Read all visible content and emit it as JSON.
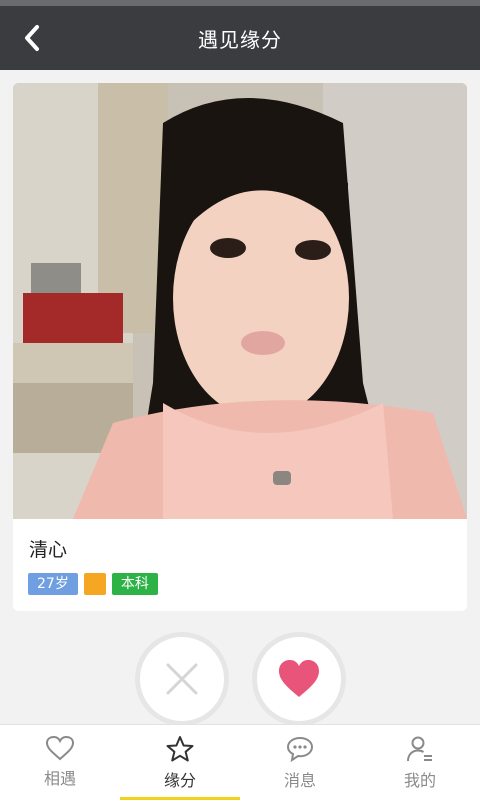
{
  "header": {
    "title": "遇见缘分",
    "back_icon": "chevron-left-icon"
  },
  "profile": {
    "name": "清心",
    "tags": {
      "age": "27岁",
      "star_color": "#f5a623",
      "education": "本科"
    }
  },
  "actions": {
    "dislike_icon": "close-icon",
    "like_icon": "heart-icon",
    "like_color": "#e9547b"
  },
  "tabs": [
    {
      "label": "相遇",
      "icon": "heart-outline-icon"
    },
    {
      "label": "缘分",
      "icon": "star-icon",
      "active": true
    },
    {
      "label": "消息",
      "icon": "chat-bubble-icon"
    },
    {
      "label": "我的",
      "icon": "user-icon"
    }
  ],
  "colors": {
    "header_bg": "#3b3c40",
    "active_tab_indicator": "#f2d31b"
  }
}
